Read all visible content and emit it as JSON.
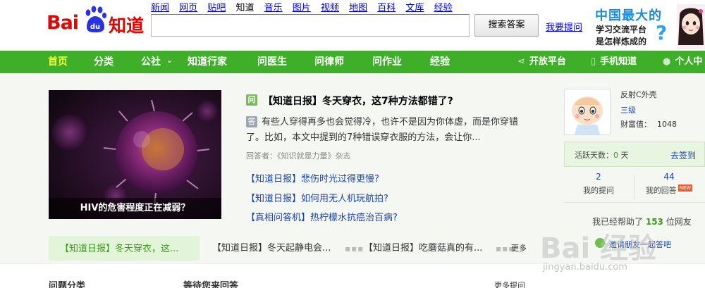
{
  "logo": {
    "text_bai": "Bai",
    "text_du": "du",
    "text_zhidao": "知道"
  },
  "topnav": {
    "items": [
      "新闻",
      "网页",
      "贴吧",
      "知道",
      "音乐",
      "图片",
      "视频",
      "地图",
      "百科",
      "文库",
      "经验"
    ],
    "current": "知道"
  },
  "search": {
    "value": "",
    "placeholder": "",
    "button": "搜索答案",
    "ask_link": "我要提问"
  },
  "promo": {
    "line1": "中国最大的",
    "line2": "学习交流平台",
    "line3": "是怎样炼成的",
    "qmark": "?"
  },
  "greennav": {
    "items": [
      "首页",
      "分类",
      "公社",
      "知道行家",
      "问医生",
      "问律师",
      "问作业",
      "经验"
    ],
    "community_chevron": "⌄",
    "right": [
      "开放平台",
      "手机知道",
      "个人中心"
    ]
  },
  "feature": {
    "caption": "HIV的危害程度正在减弱？",
    "q_badge": "问",
    "a_badge": "答",
    "title": "【知道日报】冬天穿衣，这7种方法都错了?",
    "body": "有些人穿得再多也会觉得冷，也许不是因为你体虚，而是你穿错了。比如，本文中提到的7种错误穿衣服的方法，会让你...",
    "meta": "回答者：《知识就是力量》杂志",
    "related": [
      "【知道日报】悲伤时光过得更慢?",
      "【知道日报】如何用无人机玩航拍?",
      "【真相问答机】热柠檬水抗癌治百病?"
    ]
  },
  "tabs": {
    "items": [
      "【知道日报】冬天穿衣，这...",
      "【知道日报】冬天起静电会...",
      "【知道日报】吃蘑菇真的有..."
    ],
    "separator": "▪▪▪",
    "more": "更多"
  },
  "user": {
    "name": "反射C外壳",
    "level": "三级",
    "wealth_label": "财富值：",
    "wealth": "1048",
    "active_label": "活跃天数：",
    "active_days": "0",
    "active_unit": "天",
    "sign_in": "去签到",
    "my_questions_count": "2",
    "my_questions_label": "我的提问",
    "my_answers_count": "44",
    "my_answers_label": "我的回答",
    "new_badge": "NEW",
    "helped_prefix": "我已经帮助了",
    "helped_count": "153",
    "helped_suffix": "位网友",
    "invite": "邀请朋友一起答吧"
  },
  "bottom": {
    "categories": "问题分类",
    "waiting": "等待您来回答",
    "more_questions": "更多提问"
  },
  "watermark": {
    "brand": "Bai 经验",
    "url": "jingyan.baidu.com"
  },
  "colors": {
    "brand_red": "#e10601",
    "nav_green": "#3fae29",
    "link_blue": "#1e44a3",
    "accent_green": "#3a9a1a"
  }
}
